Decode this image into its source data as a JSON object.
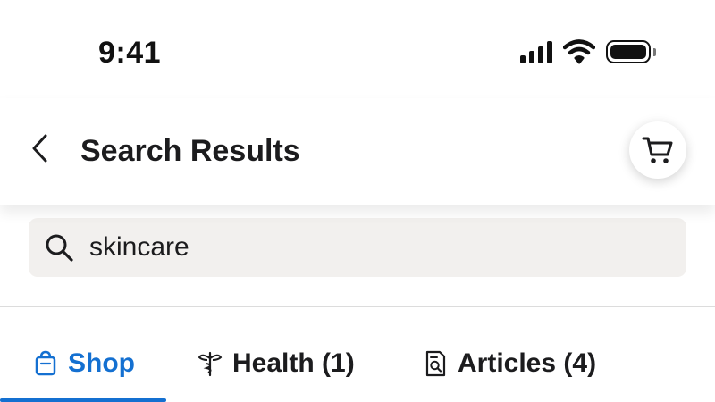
{
  "status_bar": {
    "time": "9:41"
  },
  "header": {
    "title": "Search Results"
  },
  "search": {
    "value": "skincare",
    "placeholder": ""
  },
  "tabs": [
    {
      "label": "Shop",
      "icon": "shopping-bag-icon",
      "active": true
    },
    {
      "label": "Health (1)",
      "icon": "caduceus-icon",
      "active": false
    },
    {
      "label": "Articles (4)",
      "icon": "document-search-icon",
      "active": false
    }
  ],
  "colors": {
    "accent": "#1470d1",
    "search_bg": "#f2f0ee",
    "text": "#1c1c1e"
  }
}
